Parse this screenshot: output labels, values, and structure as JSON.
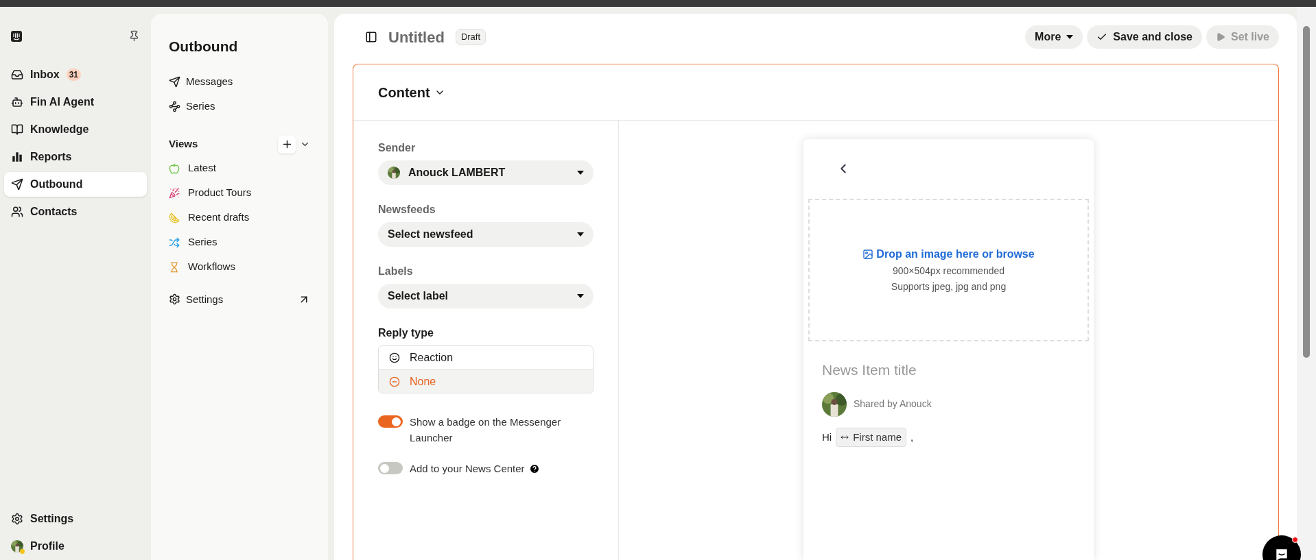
{
  "nav": {
    "items": [
      {
        "label": "Inbox",
        "badge": "31",
        "kind": "inbox",
        "selected": false
      },
      {
        "label": "Fin AI Agent",
        "kind": "fin",
        "selected": false
      },
      {
        "label": "Knowledge",
        "kind": "knowledge",
        "selected": false
      },
      {
        "label": "Reports",
        "kind": "reports",
        "selected": false
      },
      {
        "label": "Outbound",
        "kind": "outbound",
        "selected": true
      },
      {
        "label": "Contacts",
        "kind": "contacts",
        "selected": false
      }
    ],
    "bottom": [
      {
        "label": "Settings",
        "kind": "settings"
      },
      {
        "label": "Profile",
        "kind": "profile"
      }
    ]
  },
  "submenu": {
    "title": "Outbound",
    "items": [
      {
        "label": "Messages",
        "kind": "messages"
      },
      {
        "label": "Series",
        "kind": "series"
      }
    ],
    "views_title": "Views",
    "views": [
      {
        "label": "Latest",
        "kind": "apple"
      },
      {
        "label": "Product Tours",
        "kind": "party"
      },
      {
        "label": "Recent drafts",
        "kind": "lemon"
      },
      {
        "label": "Series",
        "kind": "shuffle"
      },
      {
        "label": "Workflows",
        "kind": "hourglass"
      }
    ],
    "settings": "Settings"
  },
  "header": {
    "title": "Untitled",
    "status": "Draft",
    "buttons": [
      {
        "label": "More",
        "kind": "more",
        "disabled": false
      },
      {
        "label": "Save and close",
        "kind": "save",
        "disabled": false
      },
      {
        "label": "Set live",
        "kind": "live",
        "disabled": true
      }
    ]
  },
  "content": {
    "title": "Content",
    "fields": [
      {
        "label": "Sender",
        "value": "Anouck LAMBERT",
        "avatar": true
      },
      {
        "label": "Newsfeeds",
        "value": "Select newsfeed",
        "avatar": false
      },
      {
        "label": "Labels",
        "value": "Select label",
        "avatar": false
      }
    ],
    "reply_type": {
      "label": "Reply type",
      "options": [
        {
          "label": "Reaction",
          "kind": "reaction",
          "selected": false
        },
        {
          "label": "None",
          "kind": "none",
          "selected": true
        }
      ]
    },
    "toggles": [
      {
        "label": "Show a badge on the Messenger Launcher",
        "on": true,
        "help": false
      },
      {
        "label": "Add to your News Center",
        "on": false,
        "help": true
      }
    ]
  },
  "preview": {
    "dropzone": {
      "action": "Drop an image here or browse",
      "size": "900×504px recommended",
      "formats": "Supports jpeg, jpg and png"
    },
    "title_placeholder": "News Item title",
    "author": "Shared by Anouck",
    "greeting": "Hi",
    "attribute": "First name",
    "punctuation": ","
  }
}
